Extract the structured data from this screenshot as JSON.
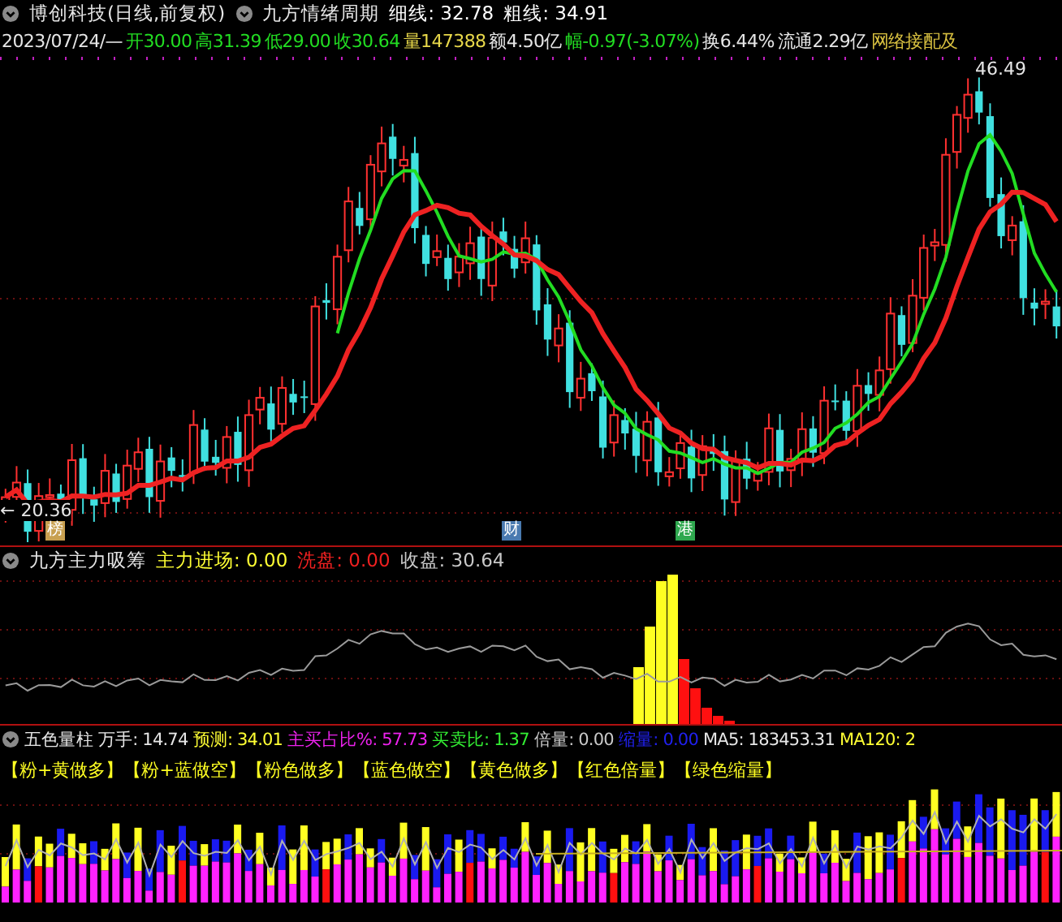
{
  "main_panel": {
    "title": "博创科技(日线,前复权)",
    "indicator": "九方情绪周期",
    "readings": [
      {
        "text": "细线: 32.78",
        "color": "#ffffff"
      },
      {
        "text": "粗线: 34.91",
        "color": "#ffffff"
      }
    ],
    "date": "2023/07/24/—",
    "quote": [
      {
        "text": "开30.00",
        "color": "#22dd22"
      },
      {
        "text": "高31.39",
        "color": "#22dd22"
      },
      {
        "text": "低29.00",
        "color": "#22dd22"
      },
      {
        "text": "收30.64",
        "color": "#22dd22"
      },
      {
        "text": "量147388",
        "color": "#e8d84a"
      },
      {
        "text": "额4.50亿",
        "color": "#e6e6e6"
      },
      {
        "text": "幅-0.97(-3.07%)",
        "color": "#22dd22"
      },
      {
        "text": "换6.44%",
        "color": "#e6e6e6"
      },
      {
        "text": "流通2.29亿",
        "color": "#e6e6e6"
      },
      {
        "text": "网络接配及",
        "color": "#d8c040"
      }
    ],
    "high_label": "46.49",
    "low_label": "← 20.36",
    "badges": [
      {
        "text": "榜",
        "color": "#c8a050"
      },
      {
        "text": "财",
        "color": "#4a7ab0"
      },
      {
        "text": "港",
        "color": "#2fa84f"
      }
    ]
  },
  "flow_panel": {
    "title": "九方主力吸筹",
    "readings": [
      {
        "text": "主力进场: 0.00",
        "color": "#ffff33"
      },
      {
        "text": "洗盘: 0.00",
        "color": "#ee2020"
      },
      {
        "text": "收盘: 30.64",
        "color": "#c8c8c8"
      }
    ]
  },
  "volume_panel": {
    "title": "五色量柱",
    "readings": [
      {
        "text": "万手: 14.74",
        "color": "#e6e6e6"
      },
      {
        "text": "预测: 34.01",
        "color": "#ffff33"
      },
      {
        "text": "主买占比%: 57.73",
        "color": "#ee22ee"
      },
      {
        "text": "买卖比: 1.37",
        "color": "#33ee33"
      },
      {
        "text": "倍量: 0.00",
        "color": "#c8c8c8"
      },
      {
        "text": "缩量: 0.00",
        "color": "#2020ee"
      },
      {
        "text": "MA5: 183453.31",
        "color": "#e6e6e6"
      },
      {
        "text": "MA120: 2",
        "color": "#ffff33"
      }
    ],
    "legend": "【粉+黄做多】【粉+蓝做空】【粉色做多】【蓝色做空】【黄色做多】【红色倍量】【绿色缩量】"
  }
}
